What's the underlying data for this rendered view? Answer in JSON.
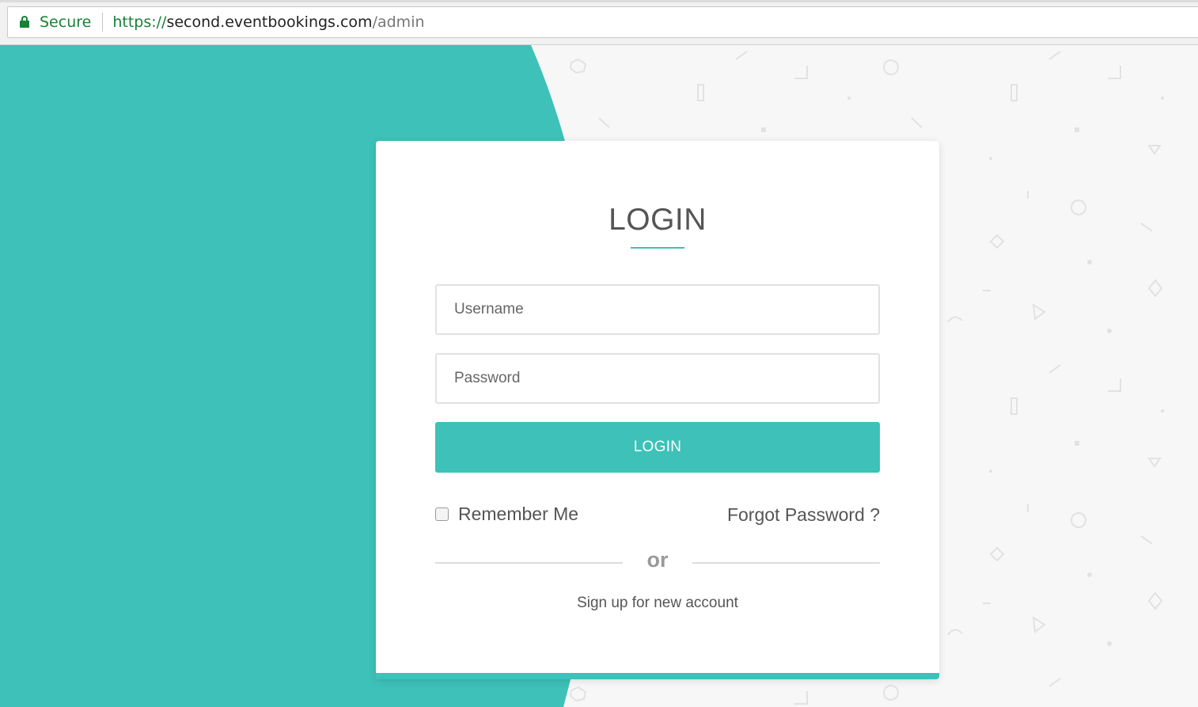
{
  "browser": {
    "secure_label": "Secure",
    "url_scheme": "https://",
    "url_host": "second.eventbookings.com",
    "url_path": "/admin"
  },
  "login": {
    "title": "LOGIN",
    "username_placeholder": "Username",
    "password_placeholder": "Password",
    "submit_label": "LOGIN",
    "remember_label": "Remember Me",
    "remember_checked": false,
    "forgot_label": "Forgot Password ?",
    "divider_text": "or",
    "signup_label": "Sign up for new account"
  },
  "colors": {
    "accent": "#3dc1b9",
    "background": "#f7f7f7",
    "card": "#ffffff",
    "secure_green": "#188038"
  }
}
